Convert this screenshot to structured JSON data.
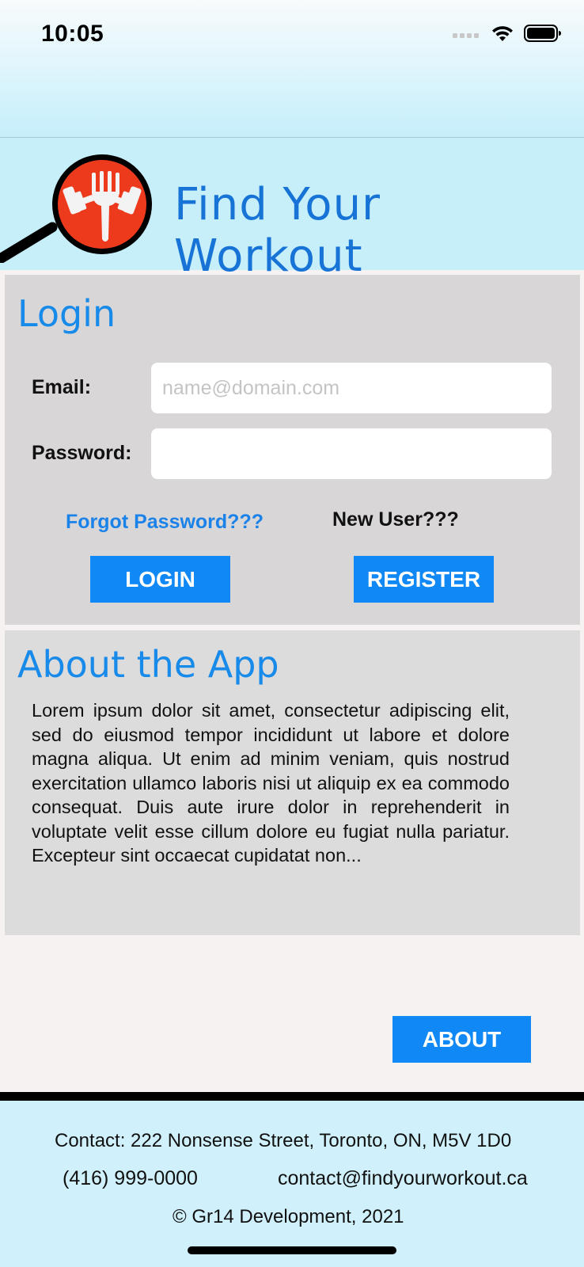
{
  "status_bar": {
    "time": "10:05",
    "icons": [
      "cellular-signal-icon",
      "wifi-icon",
      "battery-icon"
    ]
  },
  "header": {
    "app_title": "Find Your Workout",
    "logo": "magnifier-dumbbell-fork-logo"
  },
  "login": {
    "title": "Login",
    "email_label": "Email:",
    "email_placeholder": "name@domain.com",
    "email_value": "",
    "password_label": "Password:",
    "password_value": "",
    "forgot_password": "Forgot Password???",
    "new_user": "New User???",
    "login_button": "LOGIN",
    "register_button": "REGISTER"
  },
  "about": {
    "title": "About the App",
    "body": "Lorem ipsum dolor sit amet, consectetur adipiscing elit, sed do eiusmod tempor incididunt ut labore et dolore magna aliqua. Ut enim ad minim veniam, quis nostrud exercitation ullamco laboris nisi ut aliquip ex ea commodo consequat. Duis aute irure dolor in reprehenderit in voluptate velit esse cillum dolore eu fugiat nulla pariatur. Excepteur sint occaecat cupidatat non...",
    "about_button": "ABOUT"
  },
  "footer": {
    "contact": "Contact: 222 Nonsense Street, Toronto, ON, M5V 1D0",
    "phone": "(416) 999-0000",
    "email": "contact@findyourworkout.ca",
    "copyright": "© Gr14 Development, 2021"
  },
  "colors": {
    "accent": "#1089f6",
    "title_blue": "#1773d6",
    "header_bg": "#c7effa",
    "logo_red": "#ee3a1c"
  }
}
